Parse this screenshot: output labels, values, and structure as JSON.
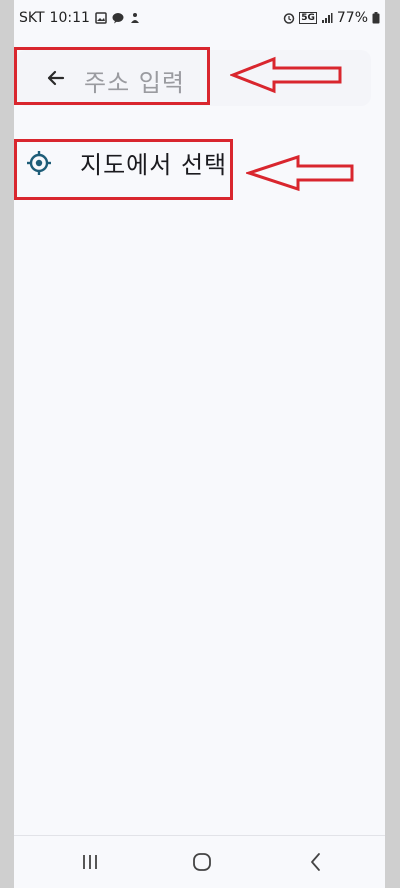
{
  "status_bar": {
    "carrier": "SKT",
    "time": "10:11",
    "network": "5G",
    "battery": "77%"
  },
  "search": {
    "placeholder": "주소 입력"
  },
  "map_select": {
    "label": "지도에서 선택"
  },
  "icons": {
    "back": "back-arrow-icon",
    "target": "target-location-icon",
    "recents": "recents-icon",
    "home": "home-icon",
    "nav_back": "nav-back-icon"
  },
  "colors": {
    "background": "#f8f9fc",
    "accent": "#1e5d78",
    "annotation": "#d9262e",
    "placeholder": "#9a9ba0"
  }
}
